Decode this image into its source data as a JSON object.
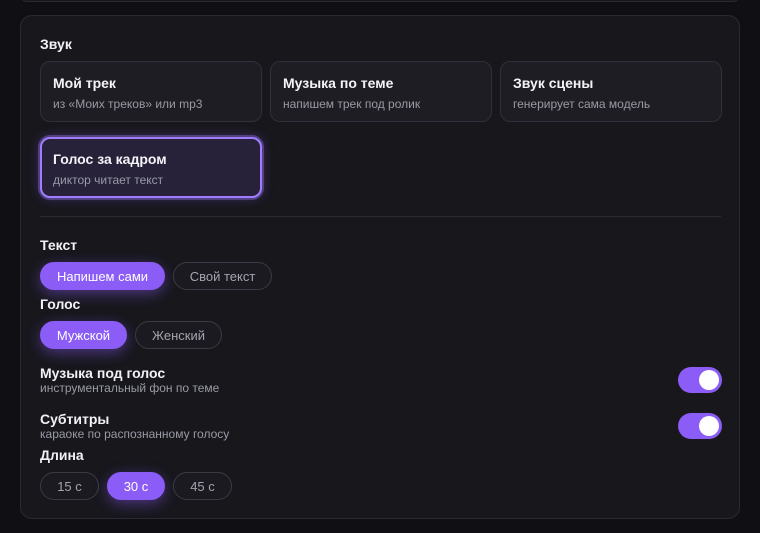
{
  "sound": {
    "title": "Звук",
    "options": [
      {
        "title": "Мой трек",
        "subtitle": "из «Моих треков» или mp3",
        "selected": false
      },
      {
        "title": "Музыка по теме",
        "subtitle": "напишем трек под ролик",
        "selected": false
      },
      {
        "title": "Звук сцены",
        "subtitle": "генерирует сама модель",
        "selected": false
      },
      {
        "title": "Голос за кадром",
        "subtitle": "диктор читает текст",
        "selected": true
      }
    ]
  },
  "text": {
    "title": "Текст",
    "options": [
      "Напишем сами",
      "Свой текст"
    ],
    "selected": "Напишем сами"
  },
  "voice": {
    "title": "Голос",
    "options": [
      "Мужской",
      "Женский"
    ],
    "selected": "Мужской"
  },
  "music_under_voice": {
    "title": "Музыка под голос",
    "subtitle": "инструментальный фон по теме",
    "enabled": true
  },
  "subtitles": {
    "title": "Субтитры",
    "subtitle": "караоке по распознанному голосу",
    "enabled": true
  },
  "length": {
    "title": "Длина",
    "options": [
      "15 с",
      "30 с",
      "45 с"
    ],
    "selected": "30 с"
  },
  "colors": {
    "accent": "#8b5cf6",
    "selected_border": "#a07cff",
    "card_bg": "#17171c",
    "page_bg": "#101014"
  }
}
